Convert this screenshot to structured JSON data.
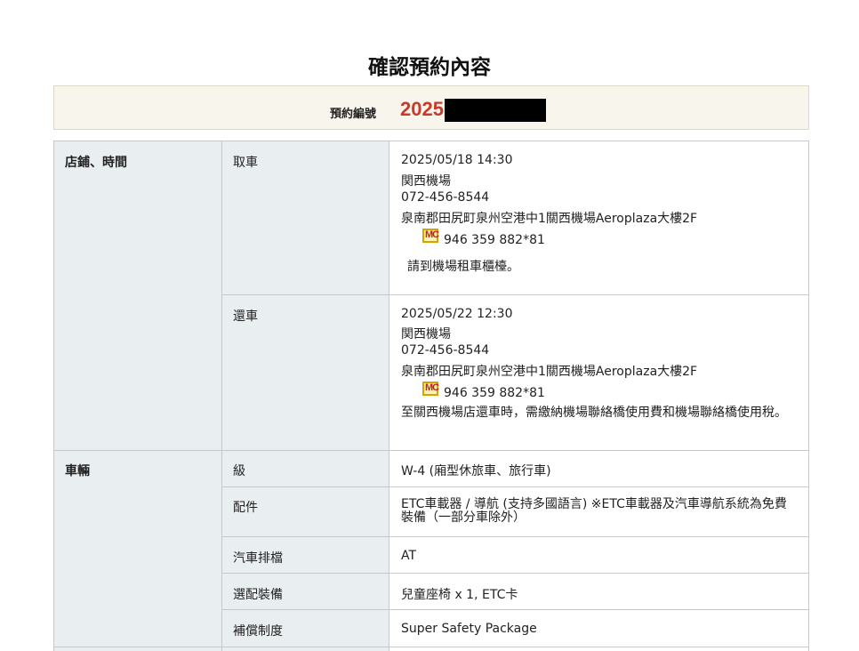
{
  "page": {
    "title": "確認預約內容"
  },
  "reservation": {
    "label": "預約編號",
    "number_visible": "2025"
  },
  "store_time": {
    "section_label": "店鋪、時間",
    "pickup": {
      "label": "取車",
      "datetime": "2025/05/18 14:30",
      "location": "関西機場",
      "phone": "072-456-8544",
      "address": "泉南郡田尻町泉州空港中1關西機場Aeroplaza大樓2F",
      "mapcode_icon": "mapcode-icon",
      "mapcode": "946 359 882*81",
      "note": "請到機場租車櫃檯。"
    },
    "return": {
      "label": "還車",
      "datetime": "2025/05/22 12:30",
      "location": "関西機場",
      "phone": "072-456-8544",
      "address": "泉南郡田尻町泉州空港中1關西機場Aeroplaza大樓2F",
      "mapcode_icon": "mapcode-icon",
      "mapcode": "946 359 882*81",
      "note": "至關西機場店還車時，需繳納機場聯絡橋使用費和機場聯絡橋使用稅。"
    }
  },
  "vehicle": {
    "section_label": "車輛",
    "class": {
      "label": "級",
      "value": "W-4 (廂型休旅車、旅行車)"
    },
    "accessories": {
      "label": "配件",
      "value": "ETC車載器 / 導航 (支持多國語言) ※ETC車載器及汽車導航系統為免費裝備（一部分車除外）"
    },
    "transmission": {
      "label": "汽車排檔",
      "value": "AT"
    },
    "options": {
      "label": "選配裝備",
      "value": "兒童座椅 x 1, ETC卡"
    },
    "insurance": {
      "label": "補償制度",
      "value": "Super Safety Package"
    }
  },
  "colors": {
    "accent_red": "#c83a2a",
    "header_bg": "#e9eef1",
    "summary_bg": "#f8f5ec"
  }
}
